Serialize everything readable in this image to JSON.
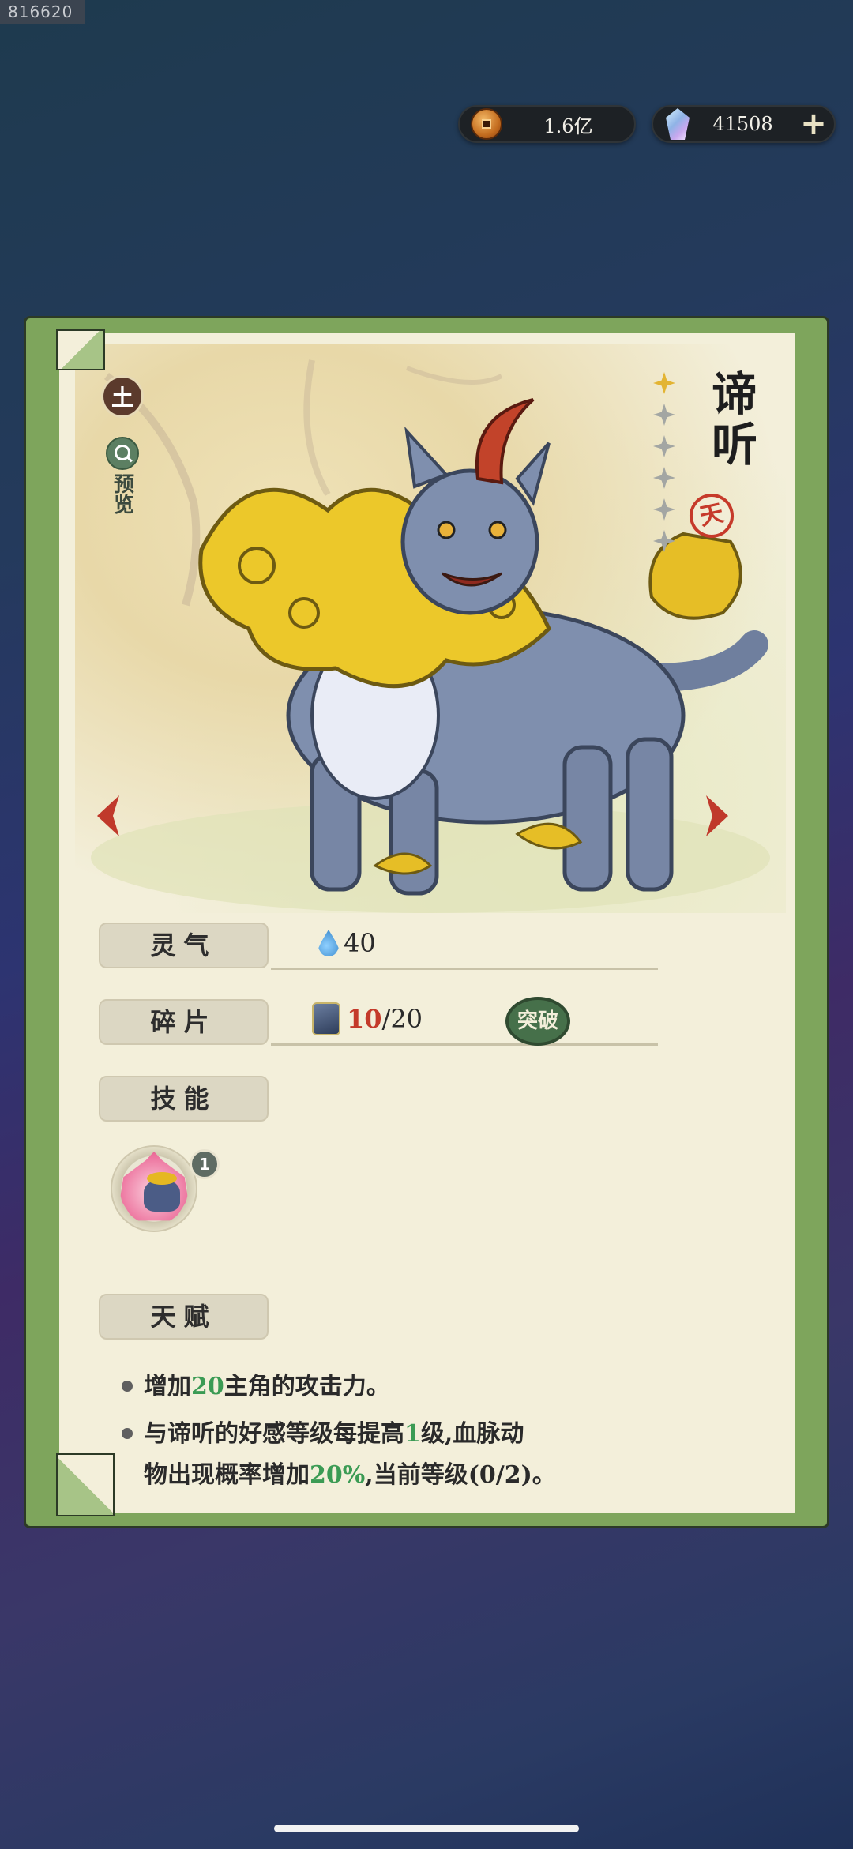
{
  "corner_id": "816620",
  "currency": {
    "coins": "1.6亿",
    "gems": "41508",
    "add_label": "+"
  },
  "character": {
    "element": "土",
    "preview_label": "预览",
    "name": "谛听",
    "grade": "天",
    "stars_total": 6,
    "stars_filled": 1
  },
  "stats": {
    "spirit_label": "灵气",
    "spirit_value": "40",
    "shard_label": "碎片",
    "shard_current": "10",
    "shard_total": "/20",
    "breakthrough_label": "突破",
    "skill_label": "技能",
    "skill_level": "1",
    "talent_label": "天赋"
  },
  "talents": [
    {
      "pre": "增加",
      "hl": "20",
      "post": "主角的攻击力。"
    },
    {
      "pre": "与谛听的好感等级每提高",
      "hl": "1",
      "mid": "级,血脉动",
      "line2a": "物出现概率增加",
      "hl2": "20%",
      "line2b": ",当前等级(0/2)。"
    }
  ],
  "colors": {
    "card_green": "#7ea55c",
    "paper": "#f3efda",
    "highlight_green": "#3b9b54",
    "shard_red": "#c43a2a",
    "arrow_red": "#c0392b"
  }
}
